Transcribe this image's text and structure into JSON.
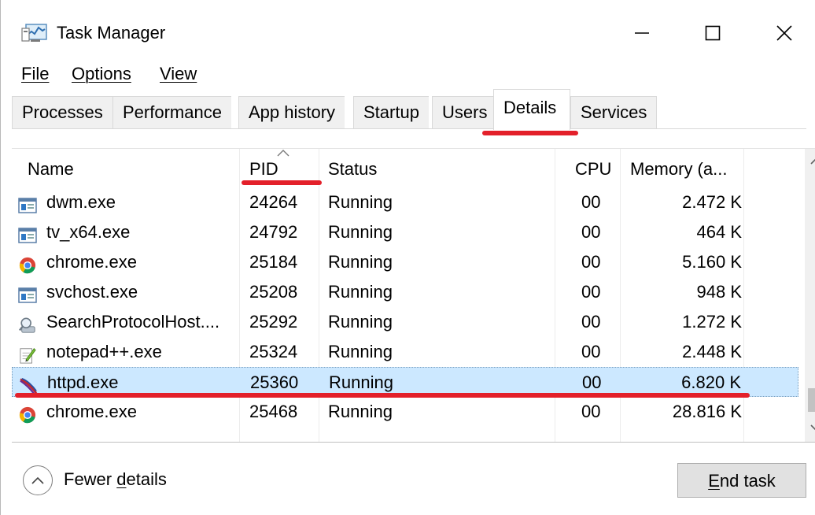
{
  "window": {
    "title": "Task Manager",
    "minimize_glyph": "—",
    "maximize_glyph": "☐",
    "close_glyph": "✕"
  },
  "menu": {
    "file": "File",
    "options": "Options",
    "view": "View"
  },
  "tabs": [
    {
      "label": "Processes"
    },
    {
      "label": "Performance"
    },
    {
      "label": "App history"
    },
    {
      "label": "Startup"
    },
    {
      "label": "Users"
    },
    {
      "label": "Details",
      "active": true
    },
    {
      "label": "Services"
    }
  ],
  "table": {
    "columns": {
      "name": "Name",
      "pid": "PID",
      "status": "Status",
      "cpu": "CPU",
      "memory": "Memory (a..."
    },
    "rows": [
      {
        "name": "dwm.exe",
        "pid": "24264",
        "status": "Running",
        "cpu": "00",
        "memory": "2.472 K",
        "icon": "app-window-icon"
      },
      {
        "name": "tv_x64.exe",
        "pid": "24792",
        "status": "Running",
        "cpu": "00",
        "memory": "464 K",
        "icon": "app-window-icon"
      },
      {
        "name": "chrome.exe",
        "pid": "25184",
        "status": "Running",
        "cpu": "00",
        "memory": "5.160 K",
        "icon": "chrome-icon"
      },
      {
        "name": "svchost.exe",
        "pid": "25208",
        "status": "Running",
        "cpu": "00",
        "memory": "948 K",
        "icon": "app-window-icon"
      },
      {
        "name": "SearchProtocolHost....",
        "pid": "25292",
        "status": "Running",
        "cpu": "00",
        "memory": "1.272 K",
        "icon": "search-protocol-icon"
      },
      {
        "name": "notepad++.exe",
        "pid": "25324",
        "status": "Running",
        "cpu": "00",
        "memory": "2.448 K",
        "icon": "notepad-plus-plus-icon"
      },
      {
        "name": "httpd.exe",
        "pid": "25360",
        "status": "Running",
        "cpu": "00",
        "memory": "6.820 K",
        "icon": "apache-feather-icon",
        "selected": true
      },
      {
        "name": "chrome.exe",
        "pid": "25468",
        "status": "Running",
        "cpu": "00",
        "memory": "28.816 K",
        "icon": "chrome-icon"
      }
    ]
  },
  "footer": {
    "fewer_details_prefix": "Fewer ",
    "fewer_details_underlined": "d",
    "fewer_details_suffix": "etails",
    "end_task_underlined": "E",
    "end_task_suffix": "nd task"
  },
  "colors": {
    "annotation_red": "#e3202a",
    "selected_row": "#cce8ff"
  }
}
